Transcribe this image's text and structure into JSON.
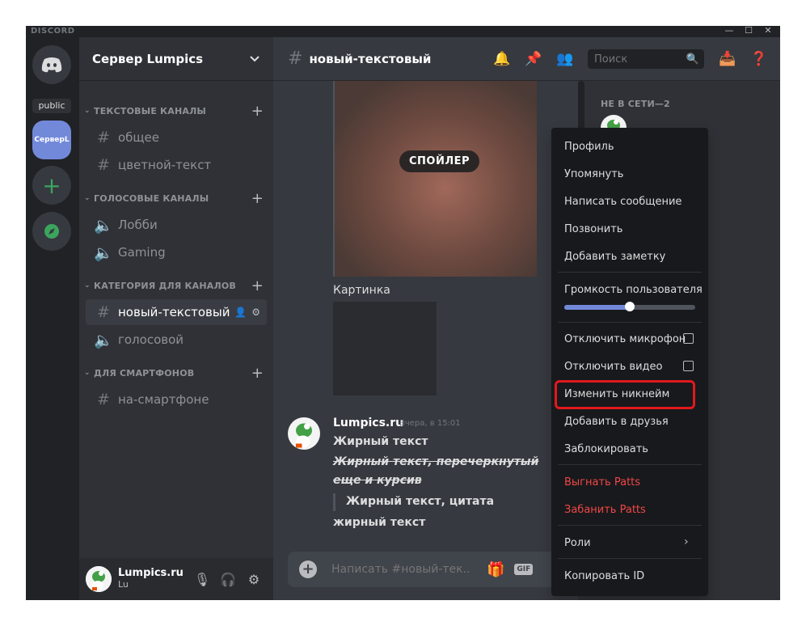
{
  "window": {
    "brand": "DISCORD",
    "minimize": "—",
    "maximize": "☐",
    "close": "✕"
  },
  "guilds": {
    "public_label": "public",
    "server_short": "СерверL",
    "add_symbol": "+",
    "explore_symbol": "◈"
  },
  "sidebar": {
    "server_name": "Сервер Lumpics",
    "categories": [
      {
        "label": "ТЕКСТОВЫЕ КАНАЛЫ",
        "channels": [
          "общее",
          "цветной-текст"
        ]
      },
      {
        "label": "ГОЛОСОВЫЕ КАНАЛЫ",
        "channels": [
          "Лобби",
          "Gaming"
        ]
      },
      {
        "label": "КАТЕГОРИЯ ДЛЯ КАНАЛОВ",
        "channels": [
          "новый-текстовый",
          "голосовой"
        ]
      },
      {
        "label": "ДЛЯ СМАРТФОНОВ",
        "channels": [
          "на-смартфоне"
        ]
      }
    ],
    "active_channel": "новый-текстовый"
  },
  "user": {
    "name": "Lumpics.ru",
    "tag": "Lu"
  },
  "chat": {
    "channel": "новый-текстовый",
    "spoiler": "СПОЙЛЕР",
    "image_label": "Картинка",
    "message": {
      "author": "Lumpics.ru",
      "time": "Вчера, в 15:01",
      "lines": [
        "Жирный текст",
        "Жирный текст, перечеркнутый",
        "еще и курсив",
        "Жирный текст, цитата",
        "жирный текст"
      ]
    },
    "composer_placeholder": "Написать #новый-тек...",
    "gif": "GIF"
  },
  "header": {
    "search_placeholder": "Поиск"
  },
  "members": {
    "offline_label": "НЕ В СЕТИ—2"
  },
  "context_menu": {
    "items": {
      "profile": "Профиль",
      "mention": "Упомянуть",
      "message": "Написать сообщение",
      "call": "Позвонить",
      "note": "Добавить заметку",
      "volume": "Громкость пользователя",
      "mute_mic": "Отключить микрофон",
      "mute_video": "Отключить видео",
      "change_nick": "Изменить никнейм",
      "add_friend": "Добавить в друзья",
      "block": "Заблокировать",
      "kick": "Выгнать Patts",
      "ban": "Забанить Patts",
      "roles": "Роли",
      "copy_id": "Копировать ID"
    },
    "volume_level": 0.5
  },
  "colors": {
    "accent": "#7289da",
    "danger": "#f04747",
    "highlight": "#e0191c",
    "online": "#3ba55d"
  }
}
